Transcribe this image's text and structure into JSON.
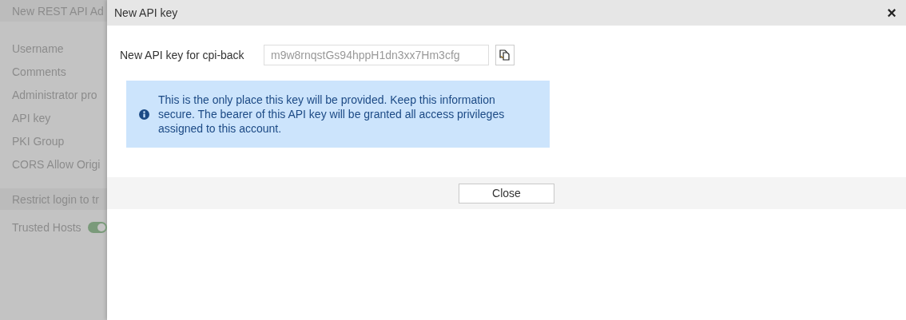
{
  "background_form": {
    "title": "New REST API Ad",
    "fields": [
      {
        "label": "Username"
      },
      {
        "label": "Comments"
      },
      {
        "label": "Administrator pro"
      },
      {
        "label": "API key"
      },
      {
        "label": "PKI Group"
      },
      {
        "label": "CORS Allow Origi"
      }
    ],
    "section": "Restrict login to tr",
    "trusted_hosts": {
      "label": "Trusted Hosts",
      "on": true
    }
  },
  "dialog": {
    "title": "New API key",
    "close": "×",
    "key_label": "New API key for cpi-back",
    "key_value": "m9w8rnqstGs94hppH1dn3xx7Hm3cfg",
    "info": "This is the only place this key will be provided. Keep this information secure. The bearer of this API key will be granted all access privileges assigned to this account.",
    "button": "Close"
  }
}
